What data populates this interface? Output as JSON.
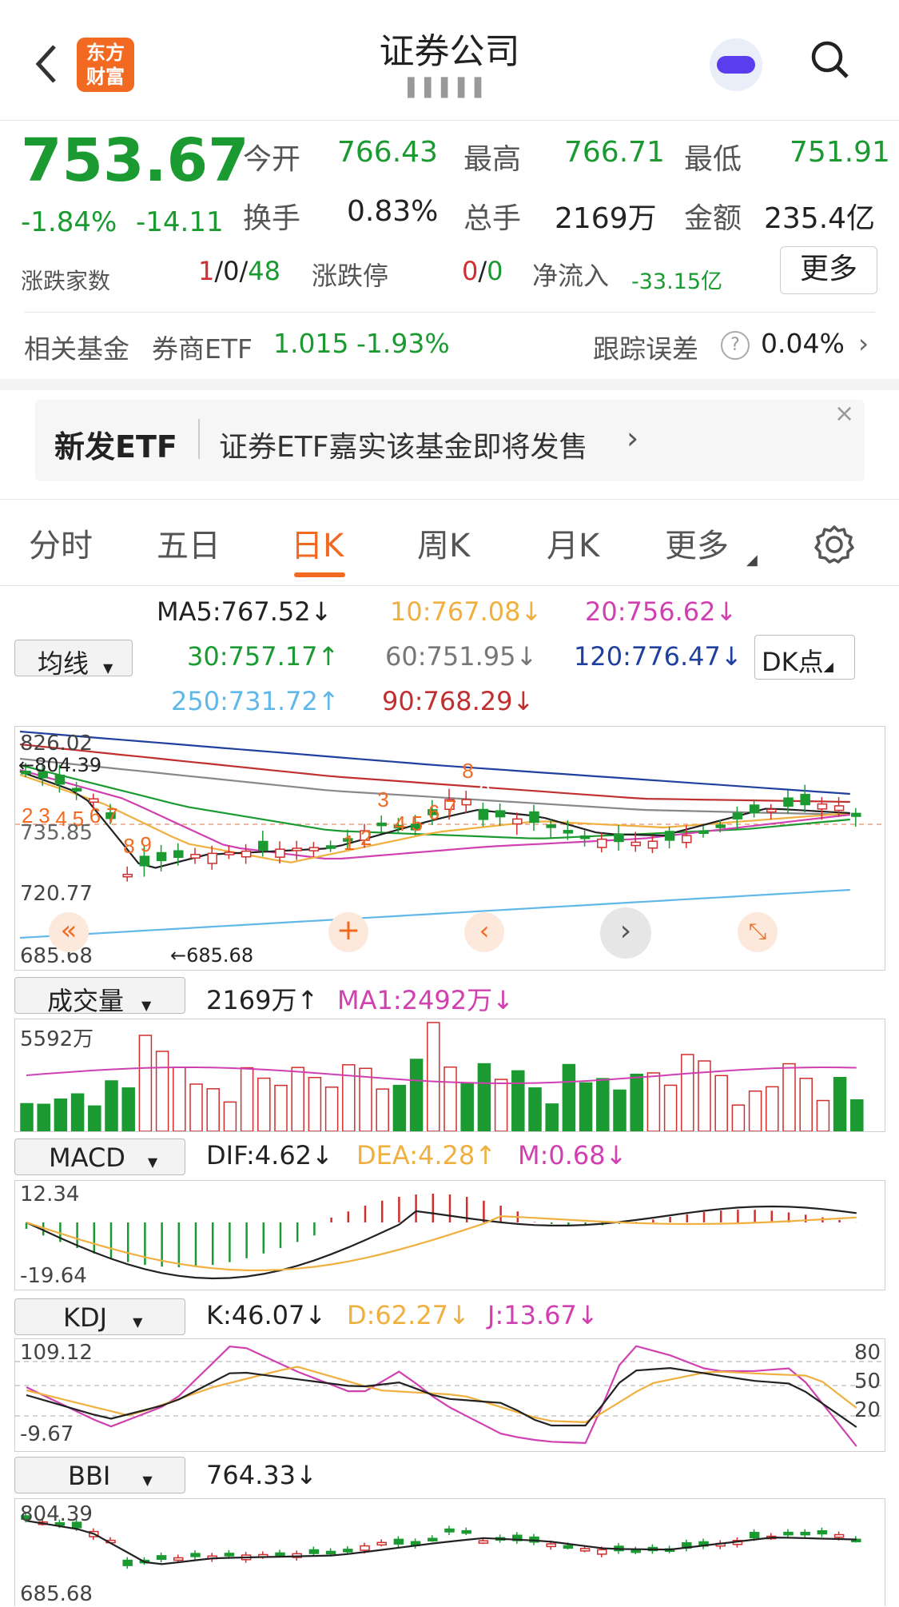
{
  "header": {
    "back_icon": "chevron-left-icon",
    "logo_text_top": "东方",
    "logo_text_bottom": "财富",
    "title": "证券公司",
    "subtitle": "▌▌▌▌▌",
    "assistant_icon": "robot-icon",
    "search_icon": "search-icon"
  },
  "quote": {
    "price": "753.67",
    "change_pct": "-1.84%",
    "change": "-14.11",
    "open_label": "今开",
    "open": "766.43",
    "high_label": "最高",
    "high": "766.71",
    "low_label": "最低",
    "low": "751.91",
    "turnover_label": "换手",
    "turnover": "0.83%",
    "volume_label": "总手",
    "volume": "2169万",
    "amount_label": "金额",
    "amount": "235.4亿",
    "updown_label": "涨跌家数",
    "up": "1",
    "sep1": "/",
    "flat": "0",
    "sep2": "/",
    "down": "48",
    "limit_label": "涨跌停",
    "limit_up": "0",
    "sep3": "/",
    "limit_down": "0",
    "netflow_label": "净流入",
    "netflow": "-33.15亿",
    "more": "更多"
  },
  "fund": {
    "label": "相关基金",
    "name": "券商ETF",
    "price": "1.015",
    "change": "-1.93%",
    "tracking_label": "跟踪误差",
    "help": "?",
    "tracking": "0.04%",
    "chevron": "›"
  },
  "banner": {
    "tag": "新发ETF",
    "text": "证券ETF嘉实该基金即将发售",
    "chevron": "›",
    "close": "×"
  },
  "tabs": [
    "分时",
    "五日",
    "日K",
    "周K",
    "月K",
    "更多"
  ],
  "active_tab": 2,
  "ma": {
    "selector": "均线",
    "dk": "DK点",
    "ma5": "MA5:767.52",
    "ma5_arrow": "↓",
    "ma10": "10:767.08",
    "ma10_arrow": "↓",
    "ma20": "20:756.62",
    "ma20_arrow": "↓",
    "ma30": "30:757.17",
    "ma30_arrow": "↑",
    "ma60": "60:751.95",
    "ma60_arrow": "↓",
    "ma120": "120:776.47",
    "ma120_arrow": "↓",
    "ma250": "250:731.72",
    "ma250_arrow": "↑",
    "ma90": "90:768.29",
    "ma90_arrow": "↓"
  },
  "kline": {
    "y_top": "826.02",
    "y_mid": "720.77",
    "y_bottom": "685.68",
    "max_label": "804.39",
    "min_label": "685.68",
    "ref": "735.85",
    "seq_labels": [
      "2",
      "3",
      "4",
      "5",
      "6",
      "7",
      "8",
      "9",
      "1",
      "2",
      "3",
      "4",
      "5",
      "6",
      "7",
      "8",
      "9"
    ]
  },
  "volume": {
    "selector": "成交量",
    "value": "2169万",
    "value_arrow": "↑",
    "ma1": "MA1:2492万",
    "ma1_arrow": "↓",
    "y_top": "5592万"
  },
  "macd": {
    "selector": "MACD",
    "dif": "DIF:4.62",
    "dif_arrow": "↓",
    "dea": "DEA:4.28",
    "dea_arrow": "↑",
    "m": "M:0.68",
    "m_arrow": "↓",
    "y_top": "12.34",
    "y_bottom": "-19.64"
  },
  "kdj": {
    "selector": "KDJ",
    "k": "K:46.07",
    "k_arrow": "↓",
    "d": "D:62.27",
    "d_arrow": "↓",
    "j": "J:13.67",
    "j_arrow": "↓",
    "y_top": "109.12",
    "y_bottom": "-9.67",
    "r80": "80",
    "r50": "50",
    "r20": "20"
  },
  "bbi": {
    "selector": "BBI",
    "value": "764.33",
    "value_arrow": "↓",
    "y_top": "804.39",
    "y_bottom": "685.68"
  },
  "colors": {
    "up": "#d12e2e",
    "down": "#1a9a31",
    "accent": "#f26a21",
    "ma5": "#222222",
    "ma10": "#f0b040",
    "ma20": "#d040b0",
    "ma30": "#1a9a31",
    "ma60": "#888888",
    "ma120": "#2040a0",
    "ma250": "#60b8e8",
    "ma90": "#c03030"
  }
}
